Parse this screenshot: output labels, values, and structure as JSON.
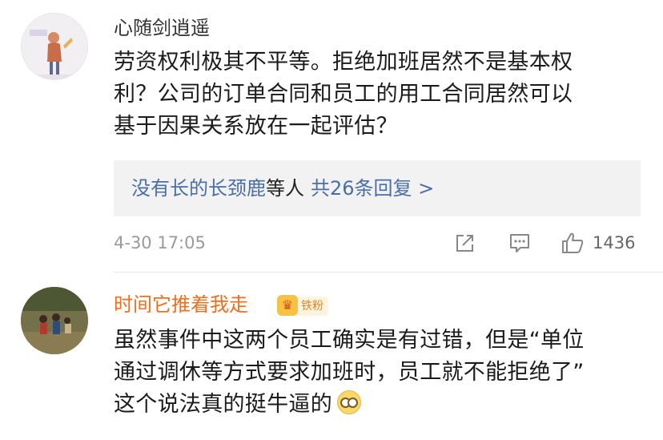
{
  "comments": [
    {
      "username": "心随剑逍遥",
      "lines": [
        "劳资权利极其不平等。拒绝加班居然不是基本权",
        "利？公司的订单合同和员工的用工合同居然可以",
        "基于因果关系放在一起评估？"
      ],
      "reply_users": "没有长的长颈鹿",
      "reply_etc": "等人",
      "reply_count": "共26条回复 >",
      "timestamp": "4-30 17:05",
      "like_count": "1436"
    },
    {
      "username": "时间它推着我走",
      "badge": "铁粉",
      "lines": [
        "虽然事件中这两个员工确实是有过错，但是“单位",
        "通过调休等方式要求加班时，员工就不能拒绝了”",
        "这个说法真的挺牛逼的"
      ],
      "emoji": "glasses-face-emoji"
    }
  ],
  "icons": [
    "share-icon",
    "comment-icon",
    "thumbs-up-icon",
    "fan-badge-icon"
  ],
  "colors": {
    "vip_username": "#f26d1c",
    "link": "#4a6fa5",
    "reply_bg": "#f2f2f2",
    "meta_text": "#9a9a9a",
    "badge_bg": "#fdf3df"
  }
}
